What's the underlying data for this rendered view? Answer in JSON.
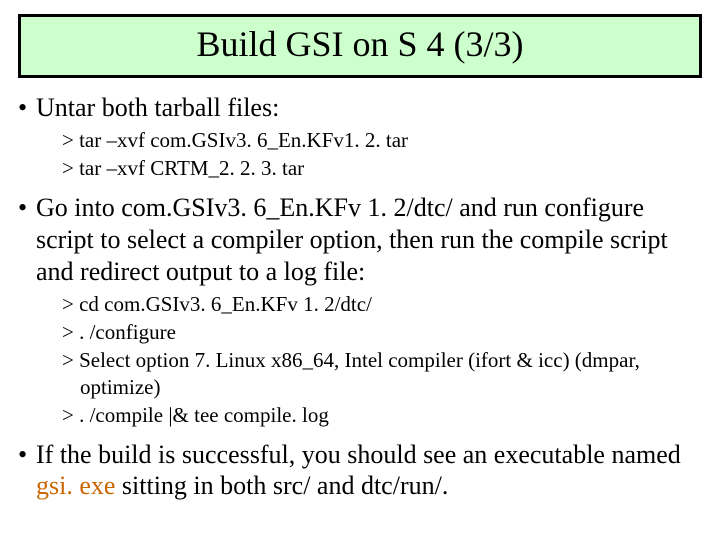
{
  "title": "Build GSI on S 4 (3/3)",
  "bullet1": "Untar both tarball files:",
  "cmds1": {
    "a": "> tar –xvf com.GSIv3. 6_En.KFv1. 2. tar",
    "b": "> tar –xvf CRTM_2. 2. 3. tar"
  },
  "bullet2": "Go into com.GSIv3. 6_En.KFv 1. 2/dtc/ and run configure script to select a compiler option, then run the compile script and redirect output to a log file:",
  "cmds2": {
    "a": "> cd com.GSIv3. 6_En.KFv 1. 2/dtc/",
    "b": "> . /configure",
    "c": "> Select option 7. Linux x86_64, Intel compiler (ifort & icc) (dmpar, optimize)",
    "d": "> . /compile |& tee compile. log"
  },
  "bullet3_a": "If the build is successful, you should see an executable named ",
  "bullet3_exe": "gsi. exe",
  "bullet3_b": " sitting in both src/ and dtc/run/."
}
